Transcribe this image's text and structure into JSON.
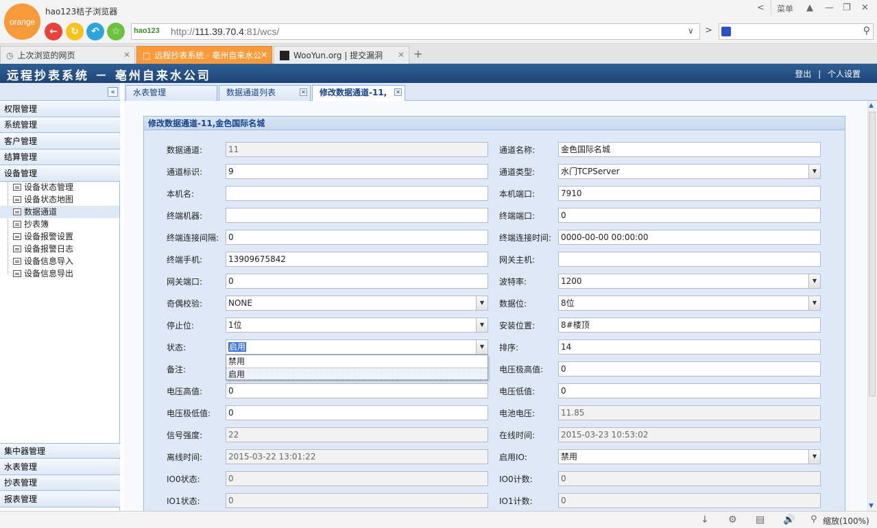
{
  "browser": {
    "logo_text": "orange",
    "name": "hao123桔子浏览器",
    "menu_label": "菜单",
    "address": {
      "logo": "hao123",
      "prefix": "http://",
      "host": "111.39.70.4",
      "rest": ":81/wcs/"
    },
    "tabs": [
      {
        "label": "上次浏览的网页"
      },
      {
        "label": "远程抄表系统 - 亳州自来水公"
      },
      {
        "label": "WooYun.org | 提交漏洞"
      }
    ],
    "zoom_label": "缩放(100%)"
  },
  "app": {
    "title": "远程抄表系统 － 亳州自来水公司",
    "logout": "登出",
    "separator": "|",
    "profile": "个人设置"
  },
  "sidebar": {
    "sections_top": [
      "权限管理",
      "系统管理",
      "客户管理",
      "结算管理",
      "设备管理"
    ],
    "device_items": [
      "设备状态管理",
      "设备状态地图",
      "数据通道",
      "抄表簿",
      "设备报警设置",
      "设备报警日志",
      "设备信息导入",
      "设备信息导出"
    ],
    "selected_item": "数据通道",
    "sections_bottom": [
      "集中器管理",
      "水表管理",
      "抄表管理",
      "报表管理"
    ]
  },
  "main_tabs": [
    {
      "label": "水表管理"
    },
    {
      "label": "数据通道列表"
    },
    {
      "label": "修改数据通道-11,"
    }
  ],
  "form": {
    "title": "修改数据通道-11,金色国际名城",
    "rows": [
      {
        "l_label": "数据通道:",
        "l_value": "11",
        "l_type": "ro",
        "r_label": "通道名称:",
        "r_value": "金色国际名城",
        "r_type": "text"
      },
      {
        "l_label": "通道标识:",
        "l_value": "9",
        "l_type": "text",
        "r_label": "通道类型:",
        "r_value": "水门TCPServer",
        "r_type": "select"
      },
      {
        "l_label": "本机名:",
        "l_value": "",
        "l_type": "text",
        "r_label": "本机端口:",
        "r_value": "7910",
        "r_type": "text"
      },
      {
        "l_label": "终端机器:",
        "l_value": "",
        "l_type": "text",
        "r_label": "终端端口:",
        "r_value": "0",
        "r_type": "text"
      },
      {
        "l_label": "终端连接间隔:",
        "l_value": "0",
        "l_type": "text",
        "r_label": "终端连接时间:",
        "r_value": "0000-00-00 00:00:00",
        "r_type": "text"
      },
      {
        "l_label": "终端手机:",
        "l_value": "13909675842",
        "l_type": "text",
        "r_label": "网关主机:",
        "r_value": "",
        "r_type": "text"
      },
      {
        "l_label": "网关端口:",
        "l_value": "0",
        "l_type": "text",
        "r_label": "波特率:",
        "r_value": "1200",
        "r_type": "select"
      },
      {
        "l_label": "奇偶校验:",
        "l_value": "NONE",
        "l_type": "select",
        "r_label": "数据位:",
        "r_value": "8位",
        "r_type": "select"
      },
      {
        "l_label": "停止位:",
        "l_value": "1位",
        "l_type": "select",
        "r_label": "安装位置:",
        "r_value": "8#楼顶",
        "r_type": "text"
      },
      {
        "l_label": "状态:",
        "l_value": "启用",
        "l_type": "select-open",
        "r_label": "排序:",
        "r_value": "14",
        "r_type": "text"
      },
      {
        "l_label": "备注:",
        "l_value": "",
        "l_type": "hidden",
        "r_label": "电压极高值:",
        "r_value": "0",
        "r_type": "text"
      },
      {
        "l_label": "电压高值:",
        "l_value": "0",
        "l_type": "text",
        "r_label": "电压低值:",
        "r_value": "0",
        "r_type": "text"
      },
      {
        "l_label": "电压极低值:",
        "l_value": "0",
        "l_type": "text",
        "r_label": "电池电压:",
        "r_value": "11.85",
        "r_type": "ro"
      },
      {
        "l_label": "信号强度:",
        "l_value": "22",
        "l_type": "ro",
        "r_label": "在线时间:",
        "r_value": "2015-03-23 10:53:02",
        "r_type": "ro"
      },
      {
        "l_label": "离线时间:",
        "l_value": "2015-03-22 13:01:22",
        "l_type": "ro",
        "r_label": "启用IO:",
        "r_value": "禁用",
        "r_type": "select"
      },
      {
        "l_label": "IO0状态:",
        "l_value": "0",
        "l_type": "ro",
        "r_label": "IO0计数:",
        "r_value": "0",
        "r_type": "ro"
      },
      {
        "l_label": "IO1状态:",
        "l_value": "0",
        "l_type": "ro",
        "r_label": "IO1计数:",
        "r_value": "0",
        "r_type": "ro"
      }
    ],
    "status_options": [
      "禁用",
      "启用"
    ]
  }
}
